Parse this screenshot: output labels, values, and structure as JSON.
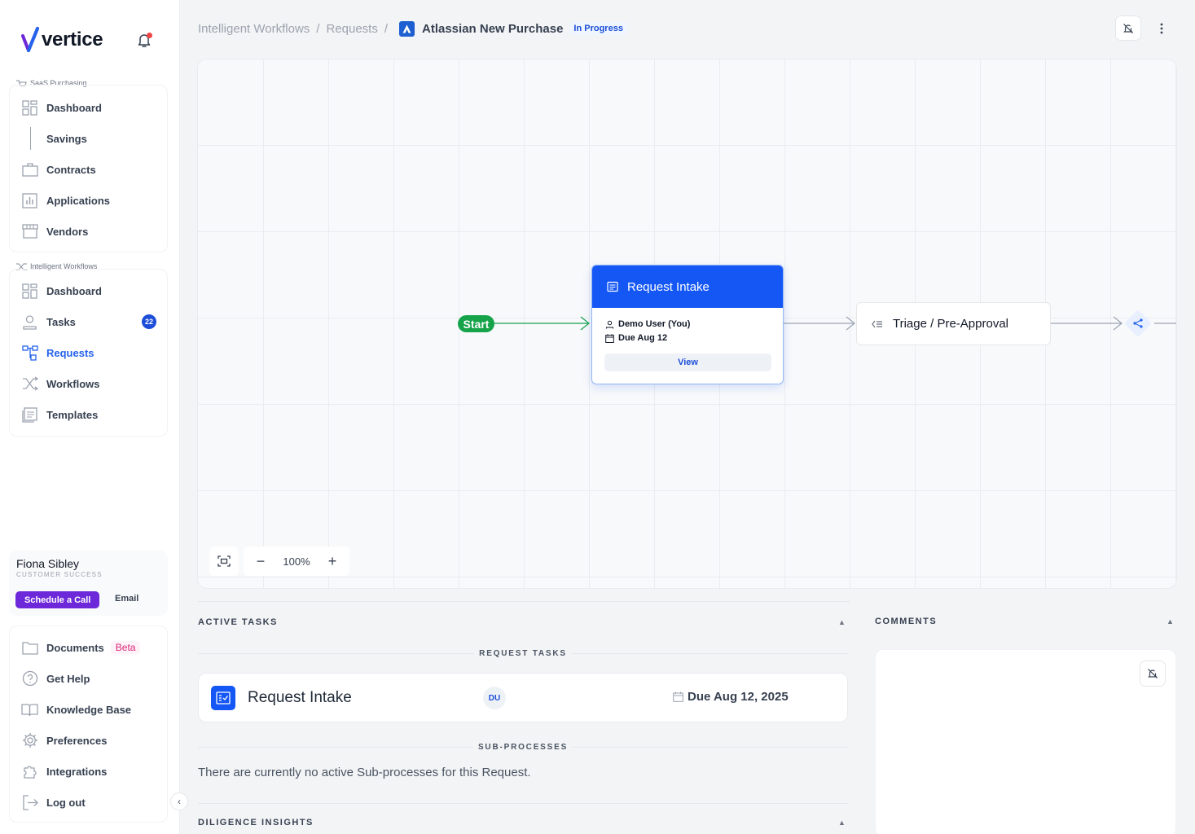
{
  "app": {
    "brand": "vertice",
    "accent": "#1457f5"
  },
  "sidebar": {
    "saas_section": "SaaS Purchasing",
    "saas_items": [
      {
        "label": "Dashboard",
        "icon": "dashboard-icon"
      },
      {
        "label": "Savings",
        "icon": "none"
      },
      {
        "label": "Contracts",
        "icon": "briefcase-icon"
      },
      {
        "label": "Applications",
        "icon": "bar-chart-icon"
      },
      {
        "label": "Vendors",
        "icon": "storefront-icon"
      }
    ],
    "workflows_section": "Intelligent Workflows",
    "workflow_items": [
      {
        "label": "Dashboard",
        "icon": "dashboard-icon"
      },
      {
        "label": "Tasks",
        "icon": "user-task-icon",
        "badge": "22"
      },
      {
        "label": "Requests",
        "icon": "hierarchy-icon",
        "active": true
      },
      {
        "label": "Workflows",
        "icon": "shuffle-icon"
      },
      {
        "label": "Templates",
        "icon": "template-icon"
      }
    ],
    "csm": {
      "name": "Fiona Sibley",
      "role": "CUSTOMER SUCCESS",
      "cta": "Schedule a Call",
      "email": "Email"
    },
    "bottom_items": [
      {
        "label": "Documents",
        "icon": "folder-icon",
        "badge": "Beta"
      },
      {
        "label": "Get Help",
        "icon": "help-icon"
      },
      {
        "label": "Knowledge Base",
        "icon": "book-icon"
      },
      {
        "label": "Preferences",
        "icon": "gear-icon"
      },
      {
        "label": "Integrations",
        "icon": "puzzle-icon"
      },
      {
        "label": "Log out",
        "icon": "logout-icon"
      }
    ]
  },
  "header": {
    "breadcrumb": [
      "Intelligent Workflows",
      "Requests"
    ],
    "separator": "/",
    "title": "Atlassian New Purchase",
    "status": "In Progress"
  },
  "flow": {
    "start": "Start",
    "intake": {
      "title": "Request Intake",
      "assignee": "Demo User (You)",
      "due": "Due Aug 12",
      "action": "View"
    },
    "triage": {
      "title": "Triage / Pre-Approval"
    },
    "zoom": "100%"
  },
  "tasks": {
    "title": "ACTIVE TASKS",
    "request_tasks_label": "REQUEST TASKS",
    "task": {
      "name": "Request Intake",
      "assignee_initials": "DU",
      "due": "Due Aug 12, 2025"
    },
    "sub_processes_label": "SUB-PROCESSES",
    "sub_processes_empty": "There are currently no active Sub-processes for this Request.",
    "diligence_title": "DILIGENCE INSIGHTS"
  },
  "comments": {
    "title": "COMMENTS"
  }
}
